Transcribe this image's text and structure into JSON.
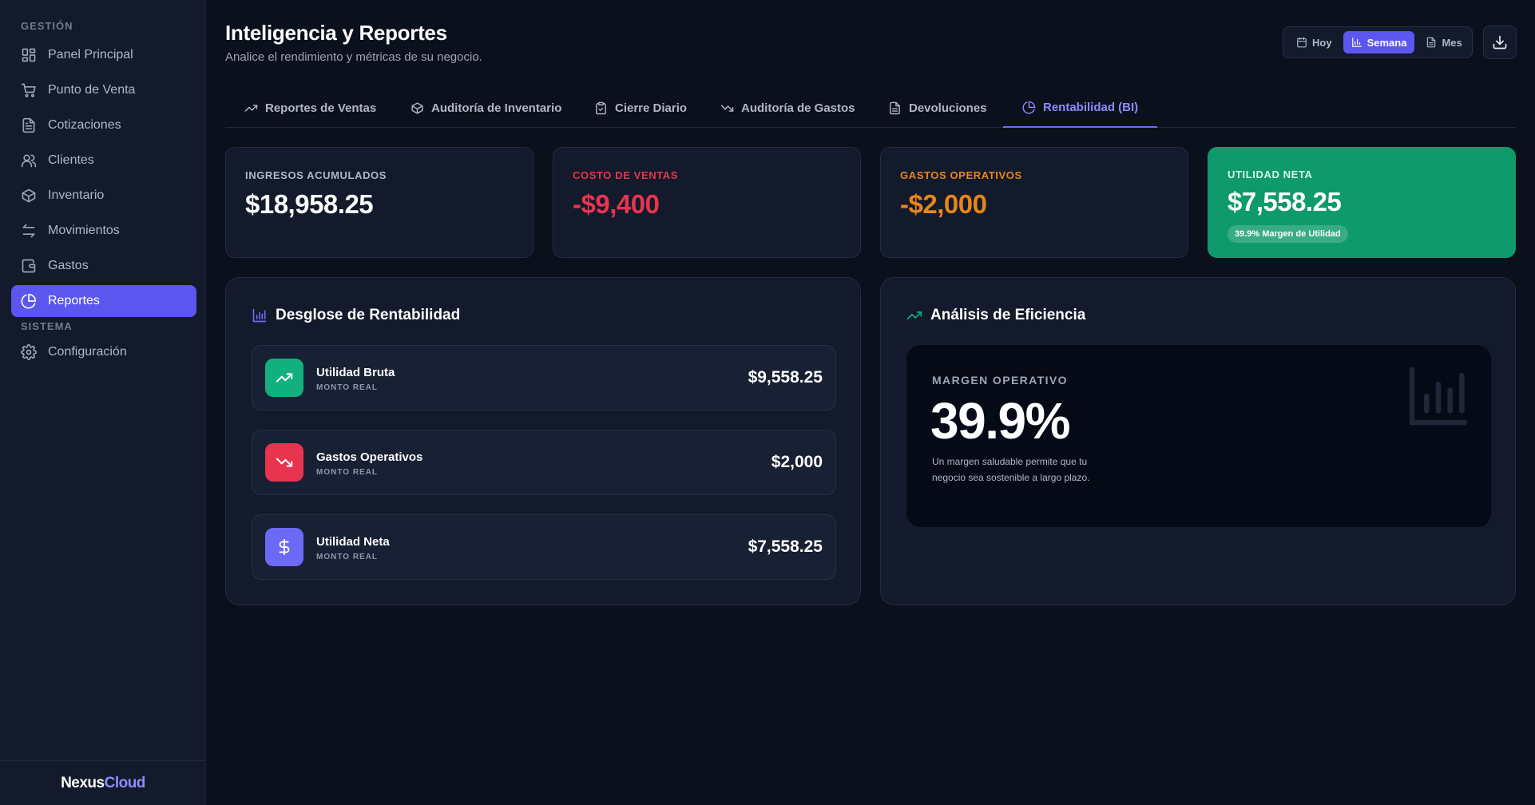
{
  "sidebar": {
    "section_gestion": "GESTIÓN",
    "section_sistema": "SISTEMA",
    "items": [
      {
        "label": "Panel Principal",
        "icon": "dashboard-icon"
      },
      {
        "label": "Punto de Venta",
        "icon": "cart-icon"
      },
      {
        "label": "Cotizaciones",
        "icon": "document-icon"
      },
      {
        "label": "Clientes",
        "icon": "users-icon"
      },
      {
        "label": "Inventario",
        "icon": "box-icon"
      },
      {
        "label": "Movimientos",
        "icon": "arrows-icon"
      },
      {
        "label": "Gastos",
        "icon": "wallet-icon"
      },
      {
        "label": "Reportes",
        "icon": "pie-chart-icon",
        "active": true
      }
    ],
    "config_label": "Configuración",
    "brand_part1": "Nexus",
    "brand_part2": "Cloud"
  },
  "header": {
    "title": "Inteligencia y Reportes",
    "subtitle": "Analice el rendimiento y métricas de su negocio.",
    "range": {
      "hoy": "Hoy",
      "semana": "Semana",
      "mes": "Mes",
      "selected": "Semana"
    }
  },
  "tabs": [
    {
      "label": "Reportes de Ventas",
      "icon": "trending-up-icon"
    },
    {
      "label": "Auditoría de Inventario",
      "icon": "box-icon"
    },
    {
      "label": "Cierre Diario",
      "icon": "clipboard-icon"
    },
    {
      "label": "Auditoría de Gastos",
      "icon": "trending-down-icon"
    },
    {
      "label": "Devoluciones",
      "icon": "document-icon"
    },
    {
      "label": "Rentabilidad (BI)",
      "icon": "pie-chart-icon",
      "active": true
    }
  ],
  "kpis": {
    "ingresos": {
      "label": "INGRESOS ACUMULADOS",
      "value": "$18,958.25"
    },
    "costo": {
      "label": "COSTO DE VENTAS",
      "value": "-$9,400"
    },
    "gastos": {
      "label": "GASTOS OPERATIVOS",
      "value": "-$2,000"
    },
    "utilidad": {
      "label": "UTILIDAD NETA",
      "value": "$7,558.25",
      "badge": "39.9% Margen de Utilidad"
    }
  },
  "breakdown": {
    "title": "Desglose de Rentabilidad",
    "rows": [
      {
        "name": "Utilidad Bruta",
        "sub": "MONTO REAL",
        "amount": "$9,558.25"
      },
      {
        "name": "Gastos Operativos",
        "sub": "MONTO REAL",
        "amount": "$2,000"
      },
      {
        "name": "Utilidad Neta",
        "sub": "MONTO REAL",
        "amount": "$7,558.25"
      }
    ]
  },
  "efficiency": {
    "title": "Análisis de Eficiencia",
    "label": "MARGEN OPERATIVO",
    "value": "39.9%",
    "note": "Un margen saludable permite que tu negocio sea sostenible a largo plazo."
  },
  "colors": {
    "accent": "#5b57ee",
    "positive": "#0e9a6a",
    "cost": "#e8344f",
    "expense": "#e8851a"
  }
}
